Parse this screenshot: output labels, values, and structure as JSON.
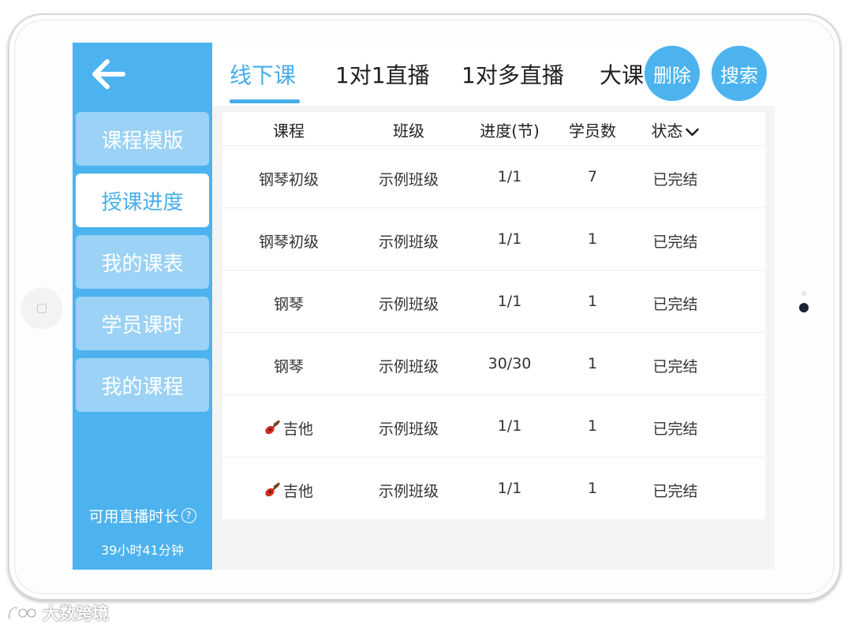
{
  "sidebar": {
    "items": [
      {
        "label": "课程模版",
        "active": false
      },
      {
        "label": "授课进度",
        "active": true
      },
      {
        "label": "我的课表",
        "active": false
      },
      {
        "label": "学员课时",
        "active": false
      },
      {
        "label": "我的课程",
        "active": false
      }
    ],
    "live_label": "可用直播时长",
    "live_value": "39小时41分钟"
  },
  "tabs": [
    {
      "label": "线下课",
      "active": true
    },
    {
      "label": "1对1直播",
      "active": false
    },
    {
      "label": "1对多直播",
      "active": false
    },
    {
      "label": "大课",
      "active": false
    }
  ],
  "buttons": {
    "delete": "删除",
    "search": "搜索"
  },
  "table": {
    "headers": [
      "课程",
      "班级",
      "进度(节)",
      "学员数",
      "状态"
    ],
    "rows": [
      {
        "course": "钢琴初级",
        "class": "示例班级",
        "progress": "1/1",
        "students": "7",
        "status": "已完结"
      },
      {
        "course": "钢琴初级",
        "class": "示例班级",
        "progress": "1/1",
        "students": "1",
        "status": "已完结"
      },
      {
        "course": "钢琴",
        "class": "示例班级",
        "progress": "1/1",
        "students": "1",
        "status": "已完结"
      },
      {
        "course": "钢琴",
        "class": "示例班级",
        "progress": "30/30",
        "students": "1",
        "status": "已完结"
      },
      {
        "course": "吉他",
        "class": "示例班级",
        "progress": "1/1",
        "students": "1",
        "status": "已完结",
        "icon": "guitar-icon"
      },
      {
        "course": "吉他",
        "class": "示例班级",
        "progress": "1/1",
        "students": "1",
        "status": "已完结",
        "icon": "guitar-icon"
      }
    ]
  },
  "watermark": "大数跨境",
  "colors": {
    "accent": "#4cb3ef",
    "accent_text": "#47aeea",
    "sidebar_item": "#9bd2f5"
  }
}
